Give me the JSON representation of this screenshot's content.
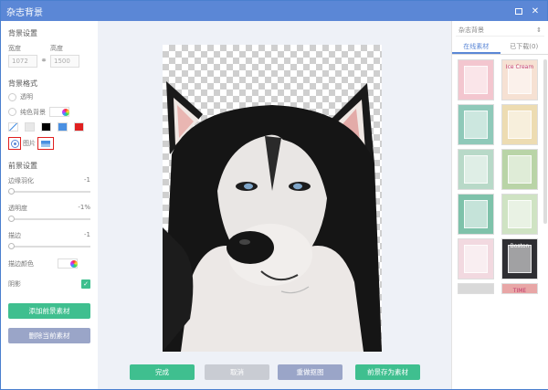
{
  "window": {
    "title": "杂志背景",
    "minimize_icon": "window-restore-icon",
    "close_icon": "close-icon"
  },
  "left": {
    "bg_settings_title": "背景设置",
    "width_label": "宽度",
    "height_label": "高度",
    "width_value": "1072",
    "height_value": "1500",
    "bg_style_title": "背景格式",
    "opt_transparent": "透明",
    "opt_solid": "纯色背景",
    "opt_image": "图片",
    "colors": [
      "#ffffff",
      "#e8e8e8",
      "#000000",
      "#4a90e2",
      "#e02020"
    ],
    "fg_settings_title": "前景设置",
    "edge_feather_label": "边缘羽化",
    "edge_feather_value": "-1",
    "opacity_label": "透明度",
    "opacity_value": "-1%",
    "stroke_label": "描边",
    "stroke_value": "-1",
    "stroke_color_label": "描边颜色",
    "shadow_label": "阴影",
    "add_fg_button": "添加前景素材",
    "delete_fg_button": "删除当前素材"
  },
  "bottom": {
    "done": "完成",
    "cancel": "取消",
    "recrop": "重做抠图",
    "save_as": "前景存为素材"
  },
  "right": {
    "category": "杂志背景",
    "tab_online": "在线素材",
    "tab_downloaded": "已下载(0)",
    "thumbs": [
      {
        "bg": "#f3c6cf",
        "text": ""
      },
      {
        "bg": "#f6e1d3",
        "text": "Ice Cream"
      },
      {
        "bg": "#8fc9b9",
        "text": ""
      },
      {
        "bg": "#eddcb2",
        "text": ""
      },
      {
        "bg": "#b8d9c8",
        "text": ""
      },
      {
        "bg": "#b9d4a7",
        "text": ""
      },
      {
        "bg": "#7ec2aa",
        "text": ""
      },
      {
        "bg": "#cfe3c3",
        "text": ""
      },
      {
        "bg": "#f2d9e0",
        "text": ""
      },
      {
        "bg": "#2f2f33",
        "text": "Boston"
      },
      {
        "bg": "#d9d9d9",
        "text": ""
      },
      {
        "bg": "#e8a6a6",
        "text": "TIME"
      }
    ]
  },
  "colors": {
    "accent": "#5b87d6",
    "green": "#3fbf8f",
    "gray_button": "#9aa5c8",
    "red_highlight": "#e02020"
  }
}
